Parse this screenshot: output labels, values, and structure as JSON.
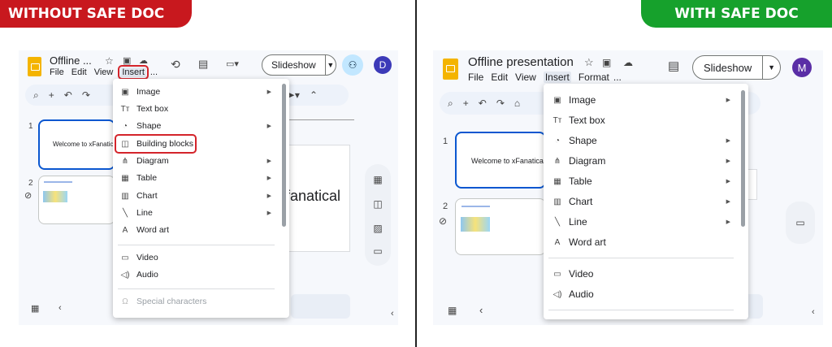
{
  "banners": {
    "left": "WITHOUT SAFE DOC",
    "right": "WITH SAFE DOC",
    "colors": {
      "left": "#c8181e",
      "right": "#16a12c"
    }
  },
  "left": {
    "doc_title": "Offline ...",
    "menubar": [
      "File",
      "Edit",
      "View",
      "Insert",
      "..."
    ],
    "slideshow_label": "Slideshow",
    "avatar_letter": "D",
    "avatar_color": "#3c3ab8",
    "slide1_text": "Welcome to xFanatical",
    "canvas_text": "fanatical",
    "slide_numbers": [
      "1",
      "2"
    ],
    "menu_items": [
      {
        "label": "Image",
        "icon": "image-icon",
        "submenu": true
      },
      {
        "label": "Text box",
        "icon": "text-box-icon",
        "submenu": false
      },
      {
        "label": "Shape",
        "icon": "shape-icon",
        "submenu": true
      },
      {
        "label": "Building blocks",
        "icon": "building-blocks-icon",
        "submenu": false
      },
      {
        "label": "Diagram",
        "icon": "diagram-icon",
        "submenu": true
      },
      {
        "label": "Table",
        "icon": "table-icon",
        "submenu": true
      },
      {
        "label": "Chart",
        "icon": "chart-icon",
        "submenu": true
      },
      {
        "label": "Line",
        "icon": "line-icon",
        "submenu": true
      },
      {
        "label": "Word art",
        "icon": "word-art-icon",
        "submenu": false
      },
      {
        "label": "Video",
        "icon": "video-icon",
        "submenu": false
      },
      {
        "label": "Audio",
        "icon": "audio-icon",
        "submenu": false
      },
      {
        "label": "Special characters",
        "icon": "omega-icon",
        "submenu": false
      }
    ]
  },
  "right": {
    "doc_title": "Offline presentation",
    "menubar": [
      "File",
      "Edit",
      "View",
      "Insert",
      "Format",
      "..."
    ],
    "slideshow_label": "Slideshow",
    "avatar_letter": "M",
    "avatar_color": "#5a2ea6",
    "slide1_text": "Welcome to xFanatical",
    "slide_numbers": [
      "1",
      "2"
    ],
    "menu_items": [
      {
        "label": "Image",
        "icon": "image-icon",
        "submenu": true
      },
      {
        "label": "Text box",
        "icon": "text-box-icon",
        "submenu": false
      },
      {
        "label": "Shape",
        "icon": "shape-icon",
        "submenu": true
      },
      {
        "label": "Diagram",
        "icon": "diagram-icon",
        "submenu": true
      },
      {
        "label": "Table",
        "icon": "table-icon",
        "submenu": true
      },
      {
        "label": "Chart",
        "icon": "chart-icon",
        "submenu": true
      },
      {
        "label": "Line",
        "icon": "line-icon",
        "submenu": true
      },
      {
        "label": "Word art",
        "icon": "word-art-icon",
        "submenu": false
      },
      {
        "label": "Video",
        "icon": "video-icon",
        "submenu": false
      },
      {
        "label": "Audio",
        "icon": "audio-icon",
        "submenu": false
      }
    ]
  }
}
